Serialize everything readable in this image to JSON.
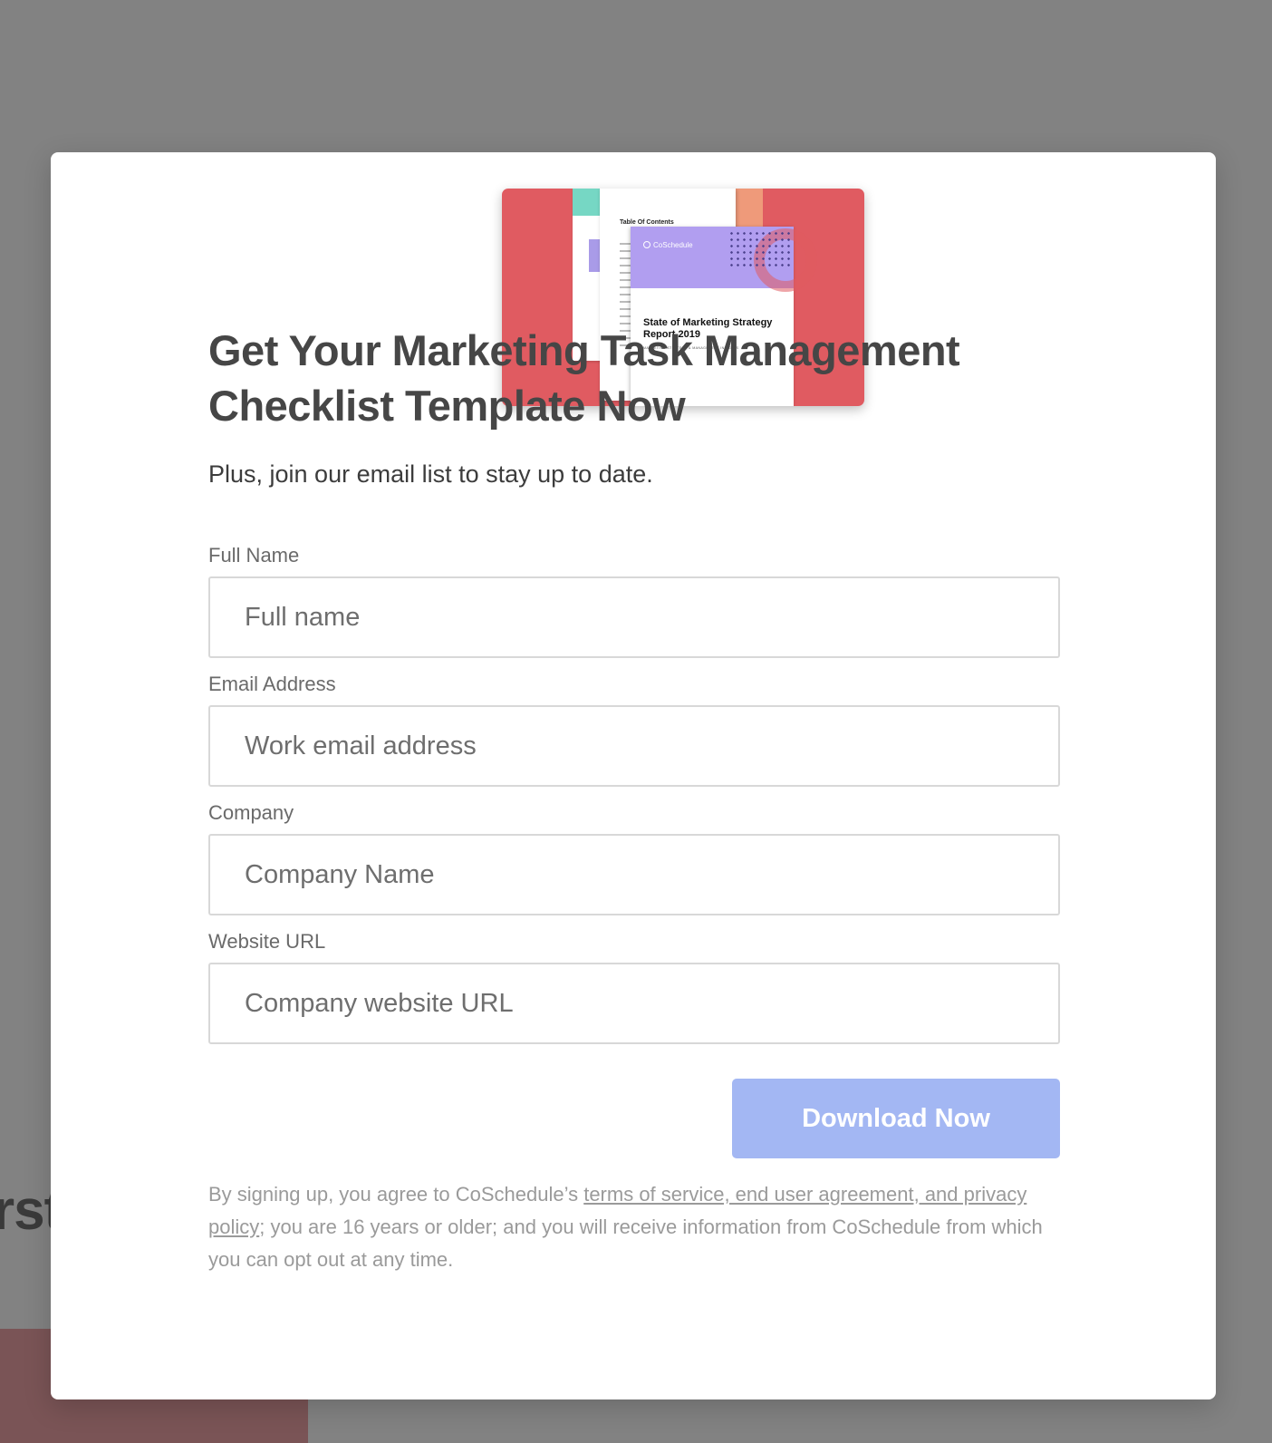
{
  "background": {
    "partial_text": "rst"
  },
  "hero": {
    "toc_title": "Table Of Contents",
    "brand": "CoSchedule",
    "report_title": "State of Marketing Strategy Report 2019",
    "report_subtitle": "MARKETING STRATEGY & MANAGEMENT INSIGHTS"
  },
  "form": {
    "title": "Get Your Marketing Task Management Checklist Template Now",
    "subtitle": "Plus, join our email list to stay up to date.",
    "fields": [
      {
        "label": "Full Name",
        "placeholder": "Full name"
      },
      {
        "label": "Email Address",
        "placeholder": "Work email address"
      },
      {
        "label": "Company",
        "placeholder": "Company Name"
      },
      {
        "label": "Website URL",
        "placeholder": "Company website URL"
      }
    ],
    "submit_label": "Download Now",
    "disclaimer": {
      "before": "By signing up, you agree to CoSchedule’s ",
      "link": "terms of service, end user agreement, and privacy policy",
      "after": "; you are 16 years or older; and you will receive information from CoSchedule from which you can opt out at any time."
    }
  },
  "colors": {
    "overlay": "#828282",
    "button": "#a3b7f3",
    "hero_bg": "#e05b61",
    "cover_purple": "#b19ef0",
    "teal": "#76d7c4",
    "orange": "#ef9a7a"
  }
}
